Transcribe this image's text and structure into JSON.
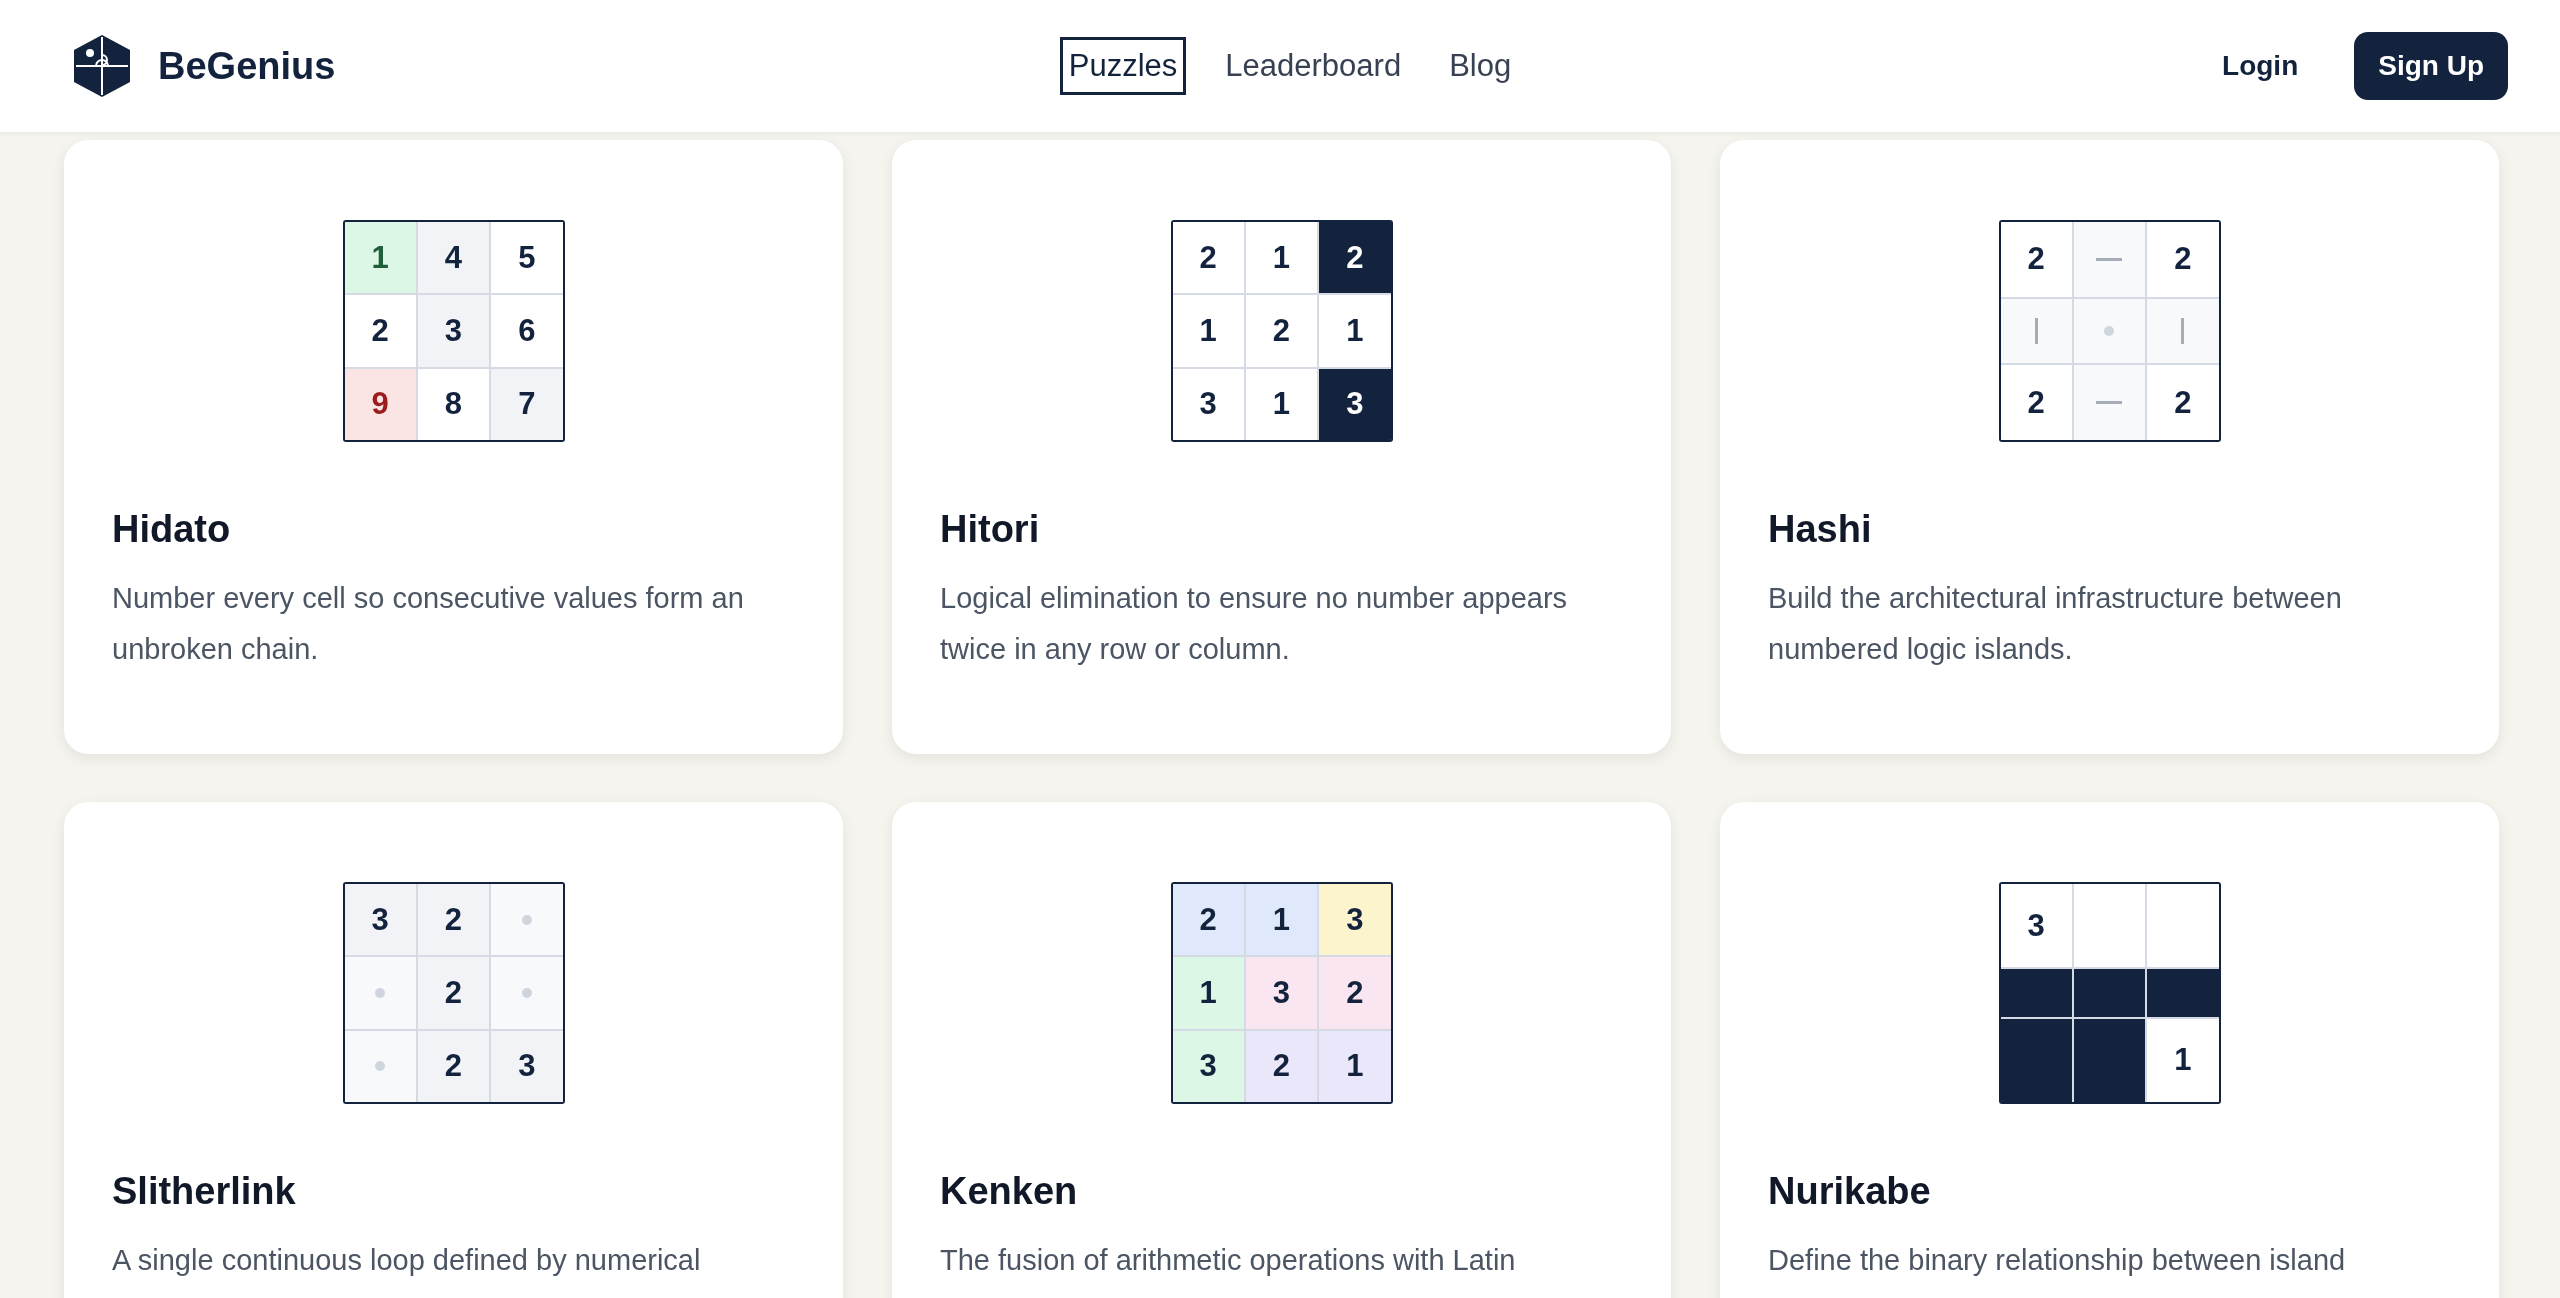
{
  "header": {
    "brand": "BeGenius",
    "nav": [
      {
        "label": "Puzzles",
        "selected": true
      },
      {
        "label": "Leaderboard",
        "selected": false
      },
      {
        "label": "Blog",
        "selected": false
      }
    ],
    "login": "Login",
    "signup": "Sign Up"
  },
  "puzzles": [
    {
      "title": "Hidato",
      "description": "Number every cell so consecutive values form an unbroken chain.",
      "grid": [
        {
          "kind": "start",
          "text": "1",
          "color": "#dcf7e6"
        },
        {
          "kind": "number",
          "text": "4",
          "color": "#f1f3f6"
        },
        {
          "kind": "number",
          "text": "5",
          "color": "#ffffff"
        },
        {
          "kind": "number",
          "text": "2",
          "color": "#ffffff"
        },
        {
          "kind": "number",
          "text": "3",
          "color": "#f1f3f6"
        },
        {
          "kind": "number",
          "text": "6",
          "color": "#ffffff"
        },
        {
          "kind": "error",
          "text": "9",
          "color": "#fbe4e4"
        },
        {
          "kind": "number",
          "text": "8",
          "color": "#ffffff"
        },
        {
          "kind": "number",
          "text": "7",
          "color": "#f1f3f6"
        }
      ]
    },
    {
      "title": "Hitori",
      "description": "Logical elimination to ensure no number appears twice in any row or column.",
      "grid": [
        {
          "kind": "number",
          "text": "2",
          "color": "#ffffff"
        },
        {
          "kind": "number",
          "text": "1",
          "color": "#ffffff"
        },
        {
          "kind": "number",
          "text": "2",
          "color": "#13233d"
        },
        {
          "kind": "number",
          "text": "1",
          "color": "#ffffff"
        },
        {
          "kind": "number",
          "text": "2",
          "color": "#ffffff"
        },
        {
          "kind": "number",
          "text": "1",
          "color": "#ffffff"
        },
        {
          "kind": "number",
          "text": "3",
          "color": "#ffffff"
        },
        {
          "kind": "number",
          "text": "1",
          "color": "#ffffff"
        },
        {
          "kind": "number",
          "text": "3",
          "color": "#13233d"
        }
      ]
    },
    {
      "title": "Hashi",
      "description": "Build the architectural infrastructure between numbered logic islands.",
      "grid": [
        {
          "kind": "number",
          "text": "2",
          "color": "#ffffff"
        },
        {
          "kind": "hbridge",
          "color": "#f8f9fb"
        },
        {
          "kind": "number",
          "text": "2",
          "color": "#ffffff"
        },
        {
          "kind": "vbridge",
          "color": "#f8f9fb"
        },
        {
          "kind": "dot",
          "color": "#f8f9fb"
        },
        {
          "kind": "vbridge",
          "color": "#f8f9fb"
        },
        {
          "kind": "number",
          "text": "2",
          "color": "#ffffff"
        },
        {
          "kind": "hbridge",
          "color": "#f8f9fb"
        },
        {
          "kind": "number",
          "text": "2",
          "color": "#ffffff"
        }
      ]
    },
    {
      "title": "Slitherlink",
      "description": "A single continuous loop defined by numerical",
      "grid": [
        {
          "kind": "number",
          "text": "3",
          "color": "#f1f3f6"
        },
        {
          "kind": "number",
          "text": "2",
          "color": "#f1f3f6"
        },
        {
          "kind": "dot",
          "color": "#f8f9fb"
        },
        {
          "kind": "dot",
          "color": "#f8f9fb"
        },
        {
          "kind": "number",
          "text": "2",
          "color": "#f1f3f6"
        },
        {
          "kind": "dot",
          "color": "#f8f9fb"
        },
        {
          "kind": "dot",
          "color": "#f8f9fb"
        },
        {
          "kind": "number",
          "text": "2",
          "color": "#f1f3f6"
        },
        {
          "kind": "number",
          "text": "3",
          "color": "#f1f3f6"
        }
      ]
    },
    {
      "title": "Kenken",
      "description": "The fusion of arithmetic operations with Latin",
      "grid": [
        {
          "kind": "number",
          "text": "2",
          "color": "#dfe9fb"
        },
        {
          "kind": "number",
          "text": "1",
          "color": "#dfe9fb"
        },
        {
          "kind": "number",
          "text": "3",
          "color": "#fcf4cc"
        },
        {
          "kind": "number",
          "text": "1",
          "color": "#dcf7e6"
        },
        {
          "kind": "number",
          "text": "3",
          "color": "#f9e6f1"
        },
        {
          "kind": "number",
          "text": "2",
          "color": "#f9e6f1"
        },
        {
          "kind": "number",
          "text": "3",
          "color": "#dcf7e6"
        },
        {
          "kind": "number",
          "text": "2",
          "color": "#ebe7fb"
        },
        {
          "kind": "number",
          "text": "1",
          "color": "#ebe7fb"
        }
      ]
    },
    {
      "title": "Nurikabe",
      "description": "Define the binary relationship between island",
      "grid": [
        {
          "kind": "number",
          "text": "3",
          "color": "#ffffff"
        },
        {
          "kind": "blank",
          "color": "#ffffff"
        },
        {
          "kind": "blank",
          "color": "#ffffff"
        },
        {
          "kind": "blank",
          "color": "#13233d"
        },
        {
          "kind": "blank",
          "color": "#13233d"
        },
        {
          "kind": "blank",
          "color": "#13233d"
        },
        {
          "kind": "blank",
          "color": "#13233d"
        },
        {
          "kind": "blank",
          "color": "#13233d"
        },
        {
          "kind": "number",
          "text": "1",
          "color": "#ffffff"
        }
      ]
    }
  ]
}
